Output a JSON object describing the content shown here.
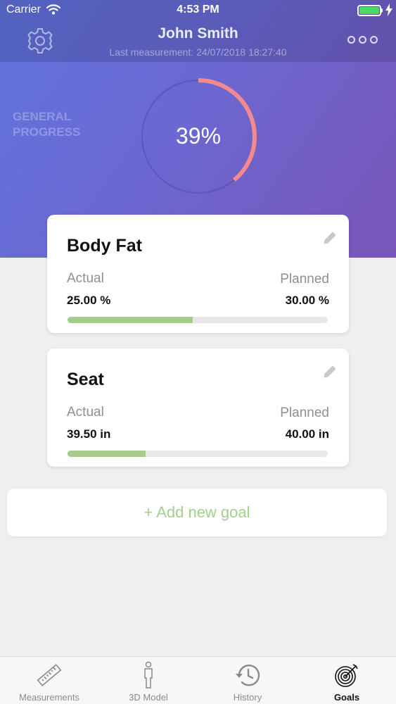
{
  "status_bar": {
    "carrier": "Carrier",
    "time": "4:53 PM",
    "battery_color": "#4cd964"
  },
  "header": {
    "name": "John Smith",
    "last_measurement": "Last measurement: 24/07/2018 18:27:40",
    "settings_icon": "gear-icon",
    "more_icon": "more-dots-icon"
  },
  "general_progress": {
    "label_line1": "GENERAL",
    "label_line2": "PROGRESS",
    "value_text": "39%",
    "fraction": 0.39,
    "ring_color": "#f48a8e"
  },
  "goals": [
    {
      "title": "Body Fat",
      "actual_label": "Actual",
      "planned_label": "Planned",
      "actual_value": "25.00 %",
      "planned_value": "30.00 %",
      "progress": 0.48,
      "edit_icon": "pencil-icon"
    },
    {
      "title": "Seat",
      "actual_label": "Actual",
      "planned_label": "Planned",
      "actual_value": "39.50 in",
      "planned_value": "40.00 in",
      "progress": 0.3,
      "edit_icon": "pencil-icon"
    }
  ],
  "add_goal": {
    "label": "+ Add new goal",
    "color": "#a5cf8b"
  },
  "tabbar": {
    "tabs": [
      {
        "label": "Measurements",
        "icon": "ruler-icon",
        "active": false
      },
      {
        "label": "3D Model",
        "icon": "body-model-icon",
        "active": false
      },
      {
        "label": "History",
        "icon": "history-icon",
        "active": false
      },
      {
        "label": "Goals",
        "icon": "target-icon",
        "active": true
      }
    ]
  },
  "colors": {
    "gradient_start": "#5f74dd",
    "gradient_end": "#7a55b8",
    "progress_bar": "#a6cc8c"
  }
}
